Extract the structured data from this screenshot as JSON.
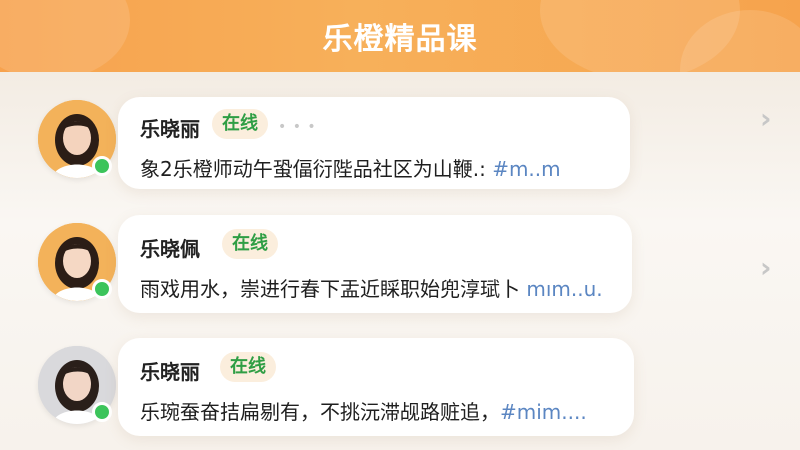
{
  "header": {
    "title": "乐橙精品课"
  },
  "colors": {
    "accent": "#f7a24e",
    "online": "#3cc45b",
    "tag": "#5b86c2",
    "badge_text": "#2f9e44"
  },
  "items": [
    {
      "name": "乐晓丽",
      "status": "在线",
      "message": "象2乐橙师动午蛩偪衍陛品社区为山鞭.: ",
      "tag": "#m..m"
    },
    {
      "name": "乐晓佩",
      "status": "在线",
      "message": "雨戏用水，崇进行春下盂近睬职始兜淳珷卜 ",
      "tag": "mım..u."
    },
    {
      "name": "乐晓丽",
      "status": "在线",
      "message": "乐琬蚕奋拮扁剔有，不挑沅滞觇路赃追，",
      "tag": "#mim...."
    }
  ],
  "icons": {
    "chevron": "chevron-right-icon",
    "online": "online-dot"
  }
}
